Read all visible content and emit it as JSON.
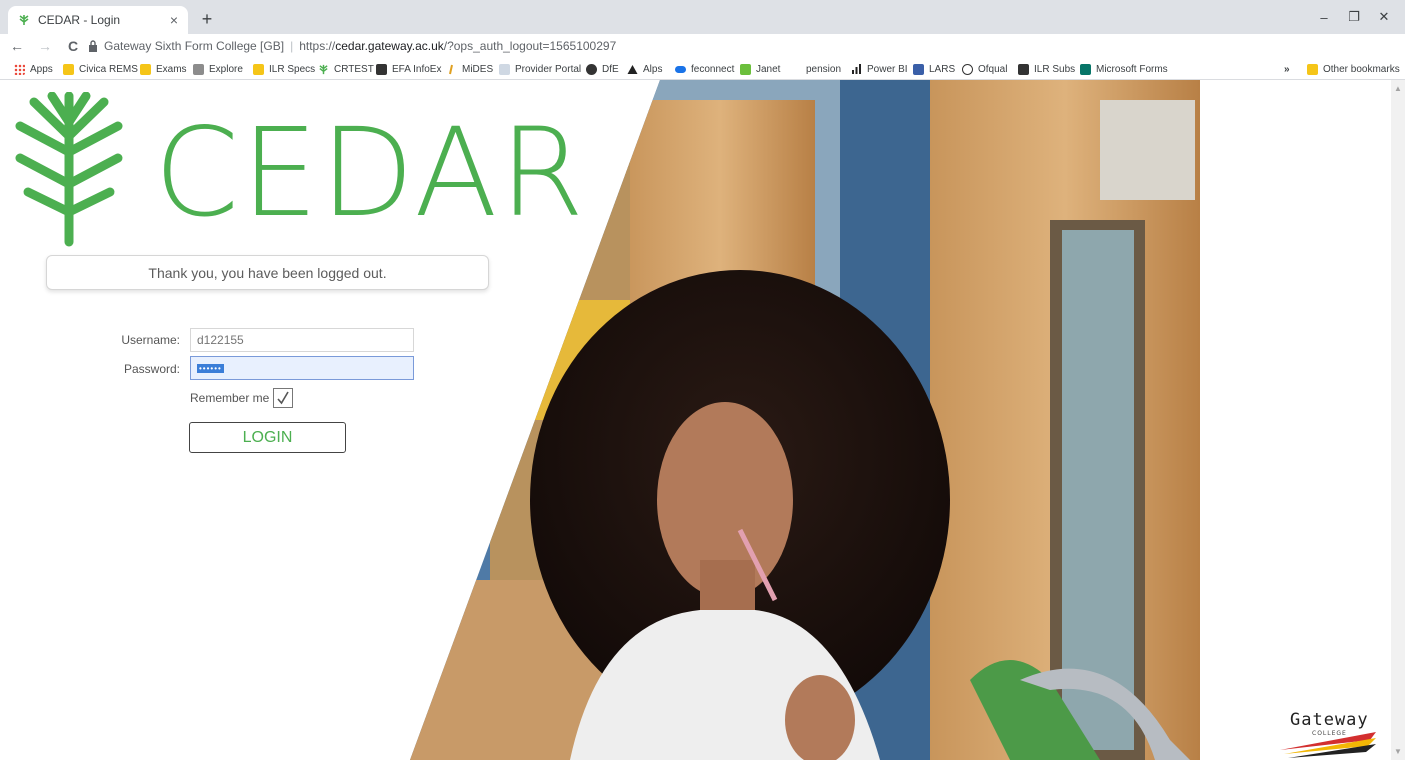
{
  "browser": {
    "tab_title": "CEDAR - Login",
    "tab_close": "×",
    "new_tab": "+",
    "window_controls": [
      "–",
      "❐",
      "✕"
    ],
    "site_identity": "Gateway Sixth Form College [GB]",
    "url_prefix": "https://",
    "url_domain": "cedar.gateway.ac.uk",
    "url_path": "/?ops_auth_logout=1565100297",
    "nav": {
      "back": "←",
      "forward": "→",
      "reload": "C"
    },
    "right_icons": [
      "key-icon",
      "zoom-icon",
      "star-icon",
      "dropbox-icon",
      "profile-icon",
      "menu-icon"
    ]
  },
  "bookmarks": {
    "items": [
      {
        "label": "Apps",
        "icon": "apps-grid-icon"
      },
      {
        "label": "Civica REMS",
        "icon": "folder-icon"
      },
      {
        "label": "Exams",
        "icon": "folder-icon"
      },
      {
        "label": "Explore",
        "icon": "explore-icon"
      },
      {
        "label": "ILR Specs",
        "icon": "folder-icon"
      },
      {
        "label": "CRTEST",
        "icon": "cedar-icon"
      },
      {
        "label": "EFA InfoEx",
        "icon": "efa-icon"
      },
      {
        "label": "MiDES",
        "icon": "mides-icon"
      },
      {
        "label": "Provider Portal",
        "icon": "portal-icon"
      },
      {
        "label": "DfE",
        "icon": "dfe-icon"
      },
      {
        "label": "Alps",
        "icon": "alps-icon"
      },
      {
        "label": "feconnect",
        "icon": "feconnect-icon"
      },
      {
        "label": "Janet",
        "icon": "janet-icon"
      },
      {
        "label": "pension",
        "icon": ""
      },
      {
        "label": "Power BI",
        "icon": "powerbi-icon"
      },
      {
        "label": "LARS",
        "icon": "lars-icon"
      },
      {
        "label": "Ofqual",
        "icon": "ofqual-icon"
      },
      {
        "label": "ILR Subs",
        "icon": "ilr-icon"
      },
      {
        "label": "Microsoft Forms",
        "icon": "forms-icon"
      }
    ],
    "overflow": "»",
    "other": "Other bookmarks"
  },
  "page": {
    "logo_text": "CEDAR",
    "message": "Thank you, you have been logged out.",
    "username_label": "Username:",
    "username_value": "d122155",
    "password_label": "Password:",
    "password_mask": "••••••",
    "remember_label": "Remember me",
    "remember_checked": true,
    "login_label": "LOGIN",
    "brand_logo_text": "Gateway",
    "brand_logo_subtext": "COLLEGE",
    "accent_color": "#4caf50"
  }
}
